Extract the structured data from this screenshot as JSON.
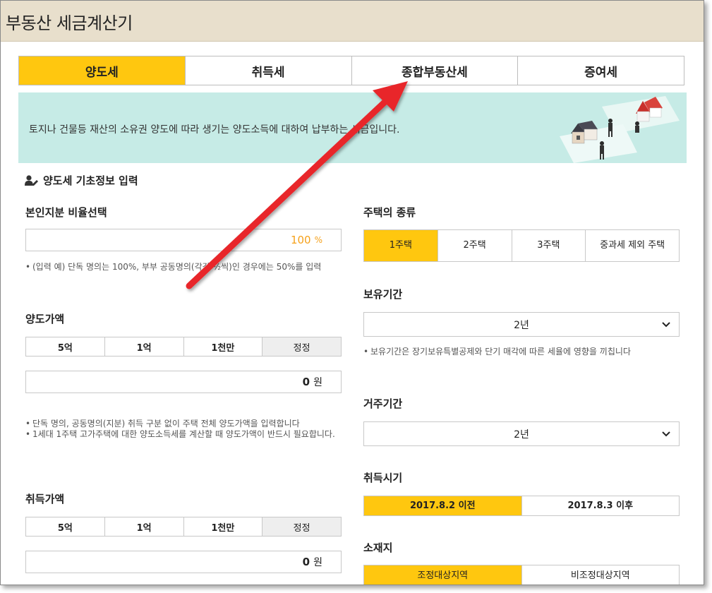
{
  "app": {
    "title": "부동산 세금계산기"
  },
  "tabs": [
    {
      "label": "양도세",
      "active": true
    },
    {
      "label": "취득세",
      "active": false
    },
    {
      "label": "종합부동산세",
      "active": false
    },
    {
      "label": "증여세",
      "active": false
    }
  ],
  "banner": {
    "description": "토지나 건물등 재산의 소유권 양도에 따라 생기는 양도소득에 대하여 납부하는 세금입니다."
  },
  "section": {
    "title": "양도세 기초정보 입력",
    "icon": "user-edit-icon"
  },
  "ownership": {
    "label": "본인지분 비율선택",
    "value": "100",
    "unit": "%",
    "note": "(입력 예) 단독 명의는 100%, 부부 공동명의(각각 ½씩)인 경우에는 50%를 입력"
  },
  "sale_price": {
    "label": "양도가액",
    "buttons": [
      "5억",
      "1억",
      "1천만",
      "정정"
    ],
    "value": "0",
    "unit": "원",
    "notes": [
      "단독 명의, 공동명의(지분) 취득 구분 없이 주택 전체 양도가액을 입력합니다",
      "1세대 1주택 고가주택에 대한 양도소득세를 계산할 때 양도가액이 반드시 필요합니다."
    ]
  },
  "acquisition_price": {
    "label": "취득가액",
    "buttons": [
      "5억",
      "1억",
      "1천만",
      "정정"
    ],
    "value": "0",
    "unit": "원"
  },
  "house_type": {
    "label": "주택의 종류",
    "options": [
      "1주택",
      "2주택",
      "3주택",
      "중과세 제외 주택"
    ],
    "selected_index": 0
  },
  "holding_period": {
    "label": "보유기간",
    "value": "2년",
    "note": "보유기간은 장기보유특별공제와 단기 매각에 따른 세율에 영향을 끼칩니다"
  },
  "residence_period": {
    "label": "거주기간",
    "value": "2년"
  },
  "acquisition_time": {
    "label": "취득시기",
    "options": [
      "2017.8.2 이전",
      "2017.8.3 이후"
    ],
    "selected_index": 0
  },
  "location": {
    "label": "소재지",
    "options": [
      "조정대상지역",
      "비조정대상지역"
    ],
    "selected_index": 0
  },
  "colors": {
    "accent": "#ffc70f",
    "banner_bg": "#c6ebe6",
    "title_bg": "#e8dfcc",
    "arrow": "#e8262c",
    "percent_text": "#f5a11b"
  }
}
